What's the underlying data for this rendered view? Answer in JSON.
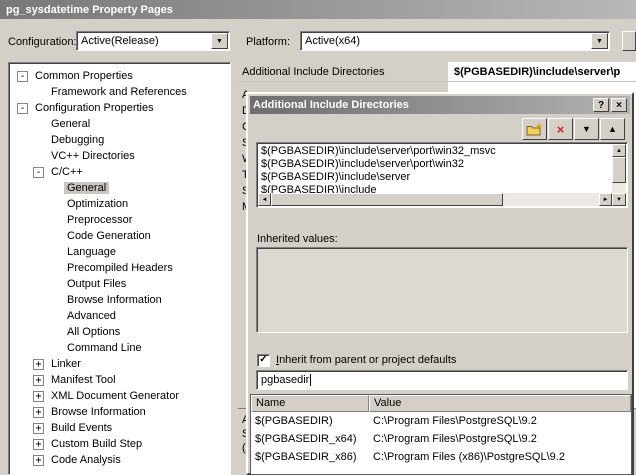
{
  "window": {
    "title": "pg_sysdatetime Property Pages"
  },
  "configbar": {
    "configuration_label": "Configuration:",
    "configuration_value": "Active(Release)",
    "platform_label": "Platform:",
    "platform_value": "Active(x64)"
  },
  "tree": {
    "items": [
      {
        "label": "Common Properties",
        "level": 0,
        "glyph": "-"
      },
      {
        "label": "Framework and References",
        "level": 1,
        "glyph": ""
      },
      {
        "label": "Configuration Properties",
        "level": 0,
        "glyph": "-"
      },
      {
        "label": "General",
        "level": 1,
        "glyph": ""
      },
      {
        "label": "Debugging",
        "level": 1,
        "glyph": ""
      },
      {
        "label": "VC++ Directories",
        "level": 1,
        "glyph": ""
      },
      {
        "label": "C/C++",
        "level": 1,
        "glyph": "-"
      },
      {
        "label": "General",
        "level": 2,
        "glyph": "",
        "selected": true
      },
      {
        "label": "Optimization",
        "level": 2,
        "glyph": ""
      },
      {
        "label": "Preprocessor",
        "level": 2,
        "glyph": ""
      },
      {
        "label": "Code Generation",
        "level": 2,
        "glyph": ""
      },
      {
        "label": "Language",
        "level": 2,
        "glyph": ""
      },
      {
        "label": "Precompiled Headers",
        "level": 2,
        "glyph": ""
      },
      {
        "label": "Output Files",
        "level": 2,
        "glyph": ""
      },
      {
        "label": "Browse Information",
        "level": 2,
        "glyph": ""
      },
      {
        "label": "Advanced",
        "level": 2,
        "glyph": ""
      },
      {
        "label": "All Options",
        "level": 2,
        "glyph": ""
      },
      {
        "label": "Command Line",
        "level": 2,
        "glyph": ""
      },
      {
        "label": "Linker",
        "level": 1,
        "glyph": "+"
      },
      {
        "label": "Manifest Tool",
        "level": 1,
        "glyph": "+"
      },
      {
        "label": "XML Document Generator",
        "level": 1,
        "glyph": "+"
      },
      {
        "label": "Browse Information",
        "level": 1,
        "glyph": "+"
      },
      {
        "label": "Build Events",
        "level": 1,
        "glyph": "+"
      },
      {
        "label": "Custom Build Step",
        "level": 1,
        "glyph": "+"
      },
      {
        "label": "Code Analysis",
        "level": 1,
        "glyph": "+"
      }
    ]
  },
  "grid": {
    "row": {
      "name": "Additional Include Directories",
      "value": "$(PGBASEDIR)\\include\\server\\p"
    },
    "clipped_rows": [
      "A",
      "D",
      "C",
      "S",
      "W",
      "Tr",
      "Sl",
      "M"
    ],
    "description_lines": [
      "Add",
      "Spec",
      "(/I[p"
    ]
  },
  "dialog": {
    "title": "Additional Include Directories",
    "list_items": [
      "$(PGBASEDIR)\\include\\server\\port\\win32_msvc",
      "$(PGBASEDIR)\\include\\server\\port\\win32",
      "$(PGBASEDIR)\\include\\server",
      "$(PGBASEDIR)\\include"
    ],
    "inherited_label": "Inherited values:",
    "checkbox": {
      "checked": true,
      "mnemonic": "I",
      "rest": "nherit from parent or project defaults"
    },
    "input_value": "pgbasedir",
    "popup": {
      "columns": [
        "Name",
        "Value"
      ],
      "rows": [
        [
          "$(PGBASEDIR)",
          "C:\\Program Files\\PostgreSQL\\9.2"
        ],
        [
          "$(PGBASEDIR_x64)",
          "C:\\Program Files\\PostgreSQL\\9.2"
        ],
        [
          "$(PGBASEDIR_x86)",
          "C:\\Program Files (x86)\\PostgreSQL\\9.2"
        ]
      ]
    }
  },
  "icons": {
    "combo_arrow": "▼",
    "scroll_up": "▲",
    "scroll_down": "▼",
    "scroll_left": "◄",
    "scroll_right": "►",
    "dialog_help": "?",
    "dialog_close": "×",
    "delete_x": "×",
    "move_down": "▼",
    "move_up": "▲",
    "checkmark": "✓"
  },
  "colors": {
    "face": "#d4d0c8",
    "titlebar_dark": "#6e6e6e",
    "titlebar_light": "#b8b8b8",
    "delete_red": "#c62828",
    "folder_yellow": "#f2cf5b"
  }
}
